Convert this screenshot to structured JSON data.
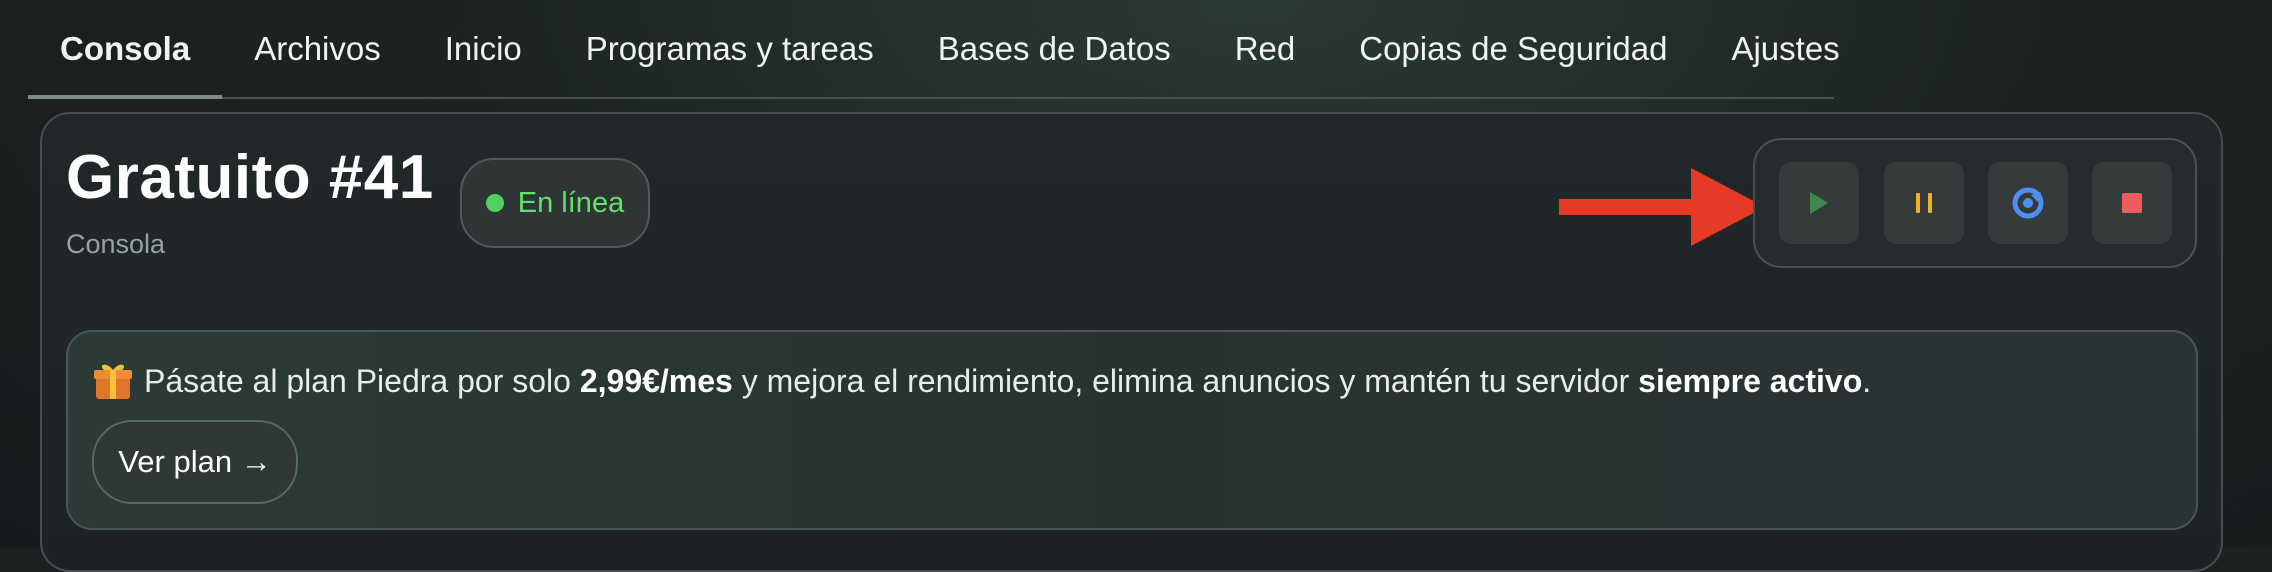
{
  "tabs": [
    {
      "label": "Consola",
      "active": true
    },
    {
      "label": "Archivos"
    },
    {
      "label": "Inicio"
    },
    {
      "label": "Programas y tareas"
    },
    {
      "label": "Bases de Datos"
    },
    {
      "label": "Red"
    },
    {
      "label": "Copias de Seguridad"
    },
    {
      "label": "Ajustes"
    }
  ],
  "server": {
    "title": "Gratuito #41",
    "subtitle": "Consola",
    "status": "En línea",
    "status_color": "#4fd15c"
  },
  "controls": {
    "start_icon": "play-icon",
    "pause_icon": "pause-icon",
    "restart_icon": "restart-icon",
    "stop_icon": "stop-icon",
    "start_color": "#3e8a4a",
    "pause_color": "#e6b52c",
    "restart_color": "#4f8fef",
    "stop_color": "#ef5c5c"
  },
  "annotation": {
    "arrow_color": "#e53a25"
  },
  "promo": {
    "icon": "gift-icon",
    "text_before": "Pásate al plan Piedra por solo ",
    "price": "2,99€/mes",
    "text_middle": " y mejora el rendimiento, elimina anuncios y mantén tu servidor ",
    "highlight": "siempre activo",
    "text_after": ".",
    "button_label": "Ver plan →"
  }
}
